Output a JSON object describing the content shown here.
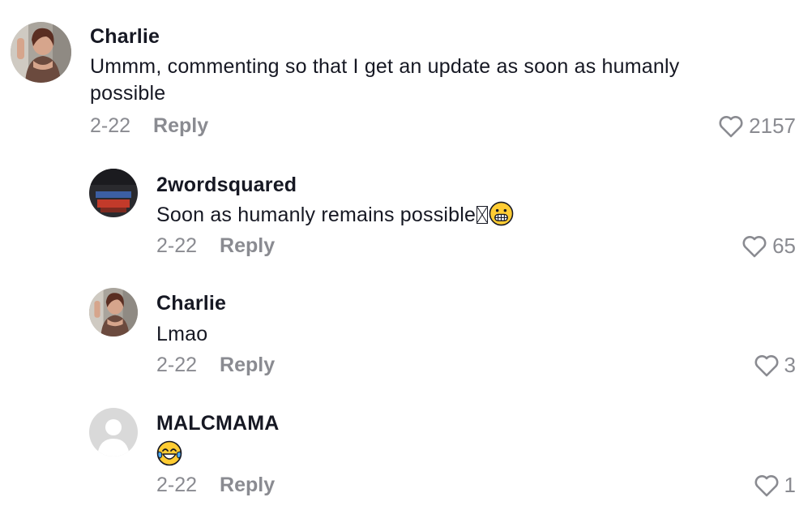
{
  "comments": [
    {
      "name": "Charlie",
      "text": "Ummm, commenting so that I get an update as soon as humanly possible",
      "date": "2-22",
      "reply_label": "Reply",
      "likes": "2157",
      "avatar": "photo-woman"
    },
    {
      "name": "2wordsquared",
      "text": "Soon as humanly remains possible",
      "date": "2-22",
      "reply_label": "Reply",
      "likes": "65",
      "avatar": "photo-shirt",
      "trailing_icons": [
        "missing-glyph-box",
        "grimacing-face-emoji"
      ]
    },
    {
      "name": "Charlie",
      "text": "Lmao",
      "date": "2-22",
      "reply_label": "Reply",
      "likes": "3",
      "avatar": "photo-woman"
    },
    {
      "name": "MALCMAMA",
      "text": "",
      "date": "2-22",
      "reply_label": "Reply",
      "likes": "1",
      "avatar": "default-avatar",
      "trailing_icons": [
        "tears-of-joy-emoji"
      ]
    }
  ],
  "colors": {
    "text": "#161823",
    "muted": "#8a8b91",
    "background": "#ffffff",
    "default_avatar_bg": "#d9d9d9"
  }
}
